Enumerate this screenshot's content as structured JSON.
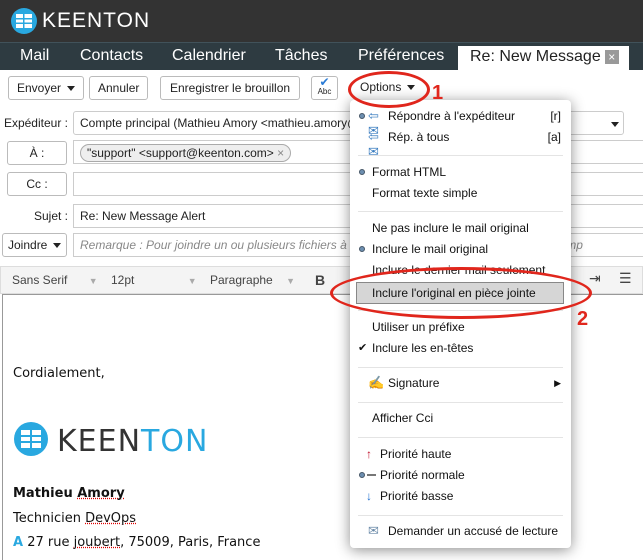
{
  "brand": {
    "name": "KEENTON",
    "accent": "#29a8e0"
  },
  "tabs": [
    {
      "label": "Mail"
    },
    {
      "label": "Contacts"
    },
    {
      "label": "Calendrier"
    },
    {
      "label": "Tâches"
    },
    {
      "label": "Préférences"
    },
    {
      "label": "Re: New Message",
      "active": true,
      "close": "×"
    }
  ],
  "toolbar": {
    "send": "Envoyer",
    "cancel": "Annuler",
    "save_draft": "Enregistrer le brouillon",
    "spell": "Abc",
    "options": "Options"
  },
  "form": {
    "from_label": "Expéditeur :",
    "from_value": "Compte principal (Mathieu Amory <mathieu.amory@",
    "to_label": "À :",
    "to_chip": "\"support\" <support@keenton.com>",
    "chip_remove": "×",
    "cc_label": "Cc :",
    "cc_value": "",
    "subject_label": "Sujet :",
    "subject_value": "Re: New Message Alert",
    "attach_label": "Joindre",
    "attach_note": "Remarque : Pour joindre un ou plusieurs fichiers à ce message, sélectionnez-les puis leur emp"
  },
  "editor_toolbar": {
    "font": "Sans Serif",
    "size": "12pt",
    "format": "Paragraphe",
    "bold": "B"
  },
  "body": {
    "closing": "Cordialement,",
    "name_first": "Mathieu",
    "name_last": "Amory",
    "title_a": "Technicien",
    "title_b": "DevOps",
    "addr_icon": "A",
    "addr_a": "27 rue",
    "addr_b": "joubert",
    "addr_c": ", 75009, Paris, France"
  },
  "menu": {
    "items": [
      {
        "label": "Répondre à l'expéditeur",
        "shortcut": "[r]",
        "selected": true,
        "icon": "reply-icon"
      },
      {
        "label": "Rép. à tous",
        "shortcut": "[a]",
        "icon": "reply-all-icon"
      },
      {
        "label": "Format HTML",
        "selected": true
      },
      {
        "label": "Format texte simple"
      },
      {
        "label": "Ne pas inclure le mail original"
      },
      {
        "label": "Inclure le mail original",
        "selected": true
      },
      {
        "label": "Inclure le dernier mail seulement"
      },
      {
        "label": "Inclure l'original en pièce jointe",
        "highlighted": true
      },
      {
        "label": "Utiliser un préfixe"
      },
      {
        "label": "Inclure les en-têtes",
        "checked": true
      },
      {
        "label": "Signature",
        "submenu": true,
        "icon": "signature-icon"
      },
      {
        "label": "Afficher Cci"
      },
      {
        "label": "Priorité haute",
        "icon": "arrow-up-icon"
      },
      {
        "label": "Priorité normale",
        "selected": true
      },
      {
        "label": "Priorité basse",
        "icon": "arrow-down-icon"
      },
      {
        "label": "Demander un accusé de lecture",
        "icon": "read-receipt-icon"
      }
    ]
  },
  "annotations": {
    "step1": "1",
    "step2": "2",
    "color": "#e0261c"
  }
}
